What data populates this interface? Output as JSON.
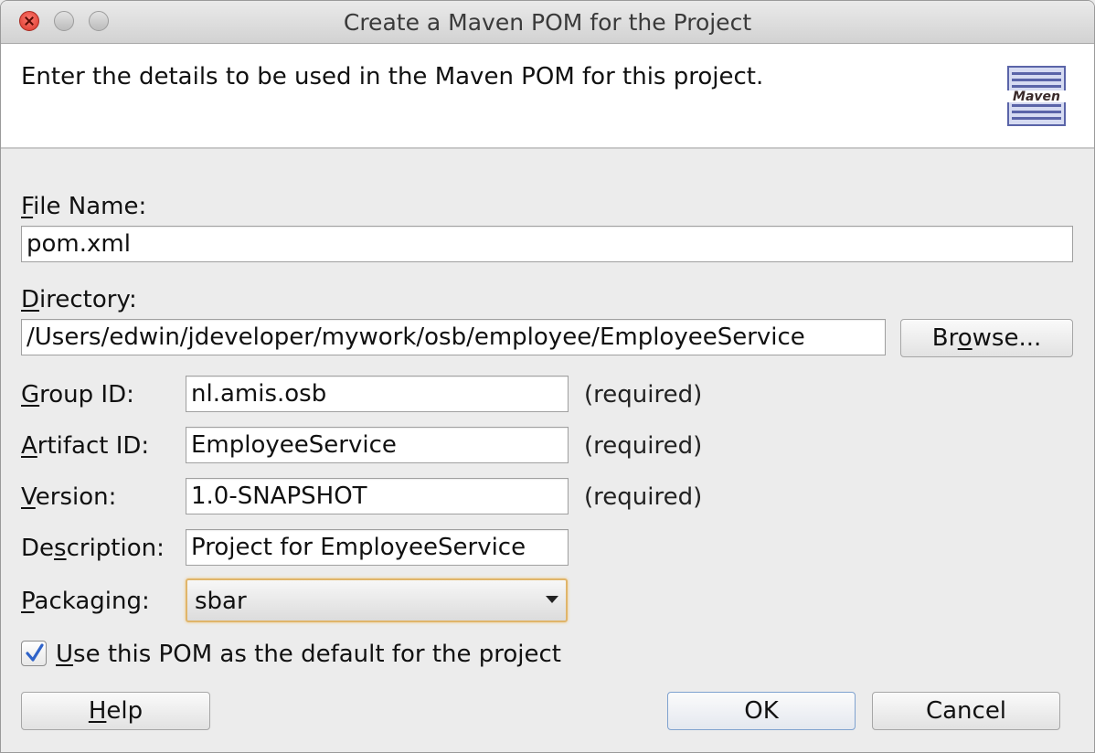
{
  "window": {
    "title": "Create a Maven POM for the Project"
  },
  "header": {
    "text": "Enter the details to be used in the Maven POM for this project.",
    "logo_text": "Maven"
  },
  "form": {
    "file_name": {
      "label_mnemonic": "F",
      "label_rest": "ile Name:",
      "value": "pom.xml"
    },
    "directory": {
      "label_mnemonic": "D",
      "label_rest": "irectory:",
      "value": "/Users/edwin/jdeveloper/mywork/osb/employee/EmployeeService"
    },
    "browse": {
      "pre": "Br",
      "mnemonic": "o",
      "post": "wse..."
    },
    "group_id": {
      "label_mnemonic": "G",
      "label_rest": "roup ID:",
      "value": "nl.amis.osb",
      "hint": "(required)"
    },
    "artifact_id": {
      "label_mnemonic": "A",
      "label_rest": "rtifact ID:",
      "value": "EmployeeService",
      "hint": "(required)"
    },
    "version": {
      "label_mnemonic": "V",
      "label_rest": "ersion:",
      "value": "1.0-SNAPSHOT",
      "hint": "(required)"
    },
    "description": {
      "label_pre": "De",
      "label_mnemonic": "s",
      "label_rest": "cription:",
      "value": "Project for EmployeeService"
    },
    "packaging": {
      "label_mnemonic": "P",
      "label_rest": "ackaging:",
      "value": "sbar"
    },
    "default_checkbox": {
      "label_mnemonic": "U",
      "label_rest": "se this POM as the default for the project",
      "checked": true
    }
  },
  "buttons": {
    "help": {
      "mnemonic": "H",
      "rest": "elp"
    },
    "ok": "OK",
    "cancel": "Cancel"
  },
  "colors": {
    "accent": "#2f63c9",
    "focus_ring": "#e0b56a"
  }
}
